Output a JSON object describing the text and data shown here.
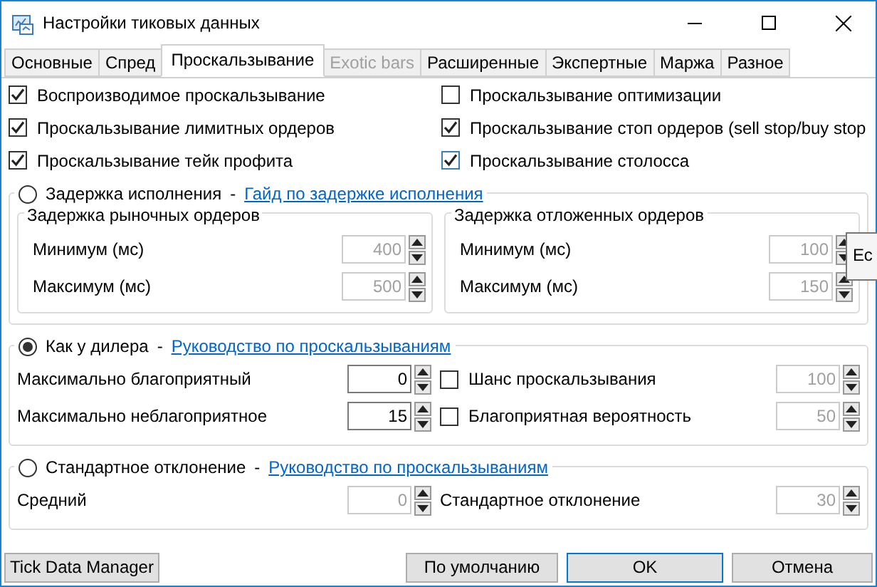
{
  "window": {
    "title": "Настройки тиковых данных"
  },
  "tabs": [
    {
      "label": "Основные",
      "selected": false,
      "disabled": false
    },
    {
      "label": "Спред",
      "selected": false,
      "disabled": false
    },
    {
      "label": "Проскальзывание",
      "selected": true,
      "disabled": false
    },
    {
      "label": "Exotic bars",
      "selected": false,
      "disabled": true
    },
    {
      "label": "Расширенные",
      "selected": false,
      "disabled": false
    },
    {
      "label": "Экспертные",
      "selected": false,
      "disabled": false
    },
    {
      "label": "Маржа",
      "selected": false,
      "disabled": false
    },
    {
      "label": "Разное",
      "selected": false,
      "disabled": false
    }
  ],
  "options": [
    {
      "label": "Воспроизводимое проскальзывание",
      "checked": true
    },
    {
      "label": "Проскальзывание оптимизации",
      "checked": false
    },
    {
      "label": "Проскальзывание лимитных ордеров",
      "checked": true
    },
    {
      "label": "Проскальзывание стоп ордеров (sell stop/buy stop",
      "checked": true
    },
    {
      "label": "Проскальзывание тейк профита",
      "checked": true
    },
    {
      "label": "Проскальзывание столосса",
      "checked": true
    }
  ],
  "tooltip": {
    "text": "Ес"
  },
  "sections": [
    {
      "label": "Задержка исполнения",
      "selected": false,
      "separator": "-",
      "link": "Гайд по задержке исполнения",
      "groups": [
        {
          "title": "Задержка рыночных ордеров",
          "fields": [
            {
              "label": "Минимум (мс)",
              "value": "400",
              "disabled": true
            },
            {
              "label": "Максимум (мс)",
              "value": "500",
              "disabled": true
            }
          ]
        },
        {
          "title": "Задержка отложенных ордеров",
          "fields": [
            {
              "label": "Минимум (мс)",
              "value": "100",
              "disabled": true
            },
            {
              "label": "Максимум (мс)",
              "value": "150",
              "disabled": true
            }
          ]
        }
      ]
    },
    {
      "label": "Как у дилера",
      "selected": true,
      "separator": "-",
      "link": "Руководство по проскальзываниям",
      "rows": [
        {
          "items": [
            {
              "kind": "field",
              "label": "Максимально благоприятный",
              "value": "0",
              "disabled": false
            },
            {
              "kind": "check",
              "label": "Шанс проскальзывания",
              "checked": false,
              "value": "100",
              "disabled": true
            }
          ]
        },
        {
          "items": [
            {
              "kind": "field",
              "label": "Максимально неблагоприятное",
              "value": "15",
              "disabled": false
            },
            {
              "kind": "check",
              "label": "Благоприятная вероятность",
              "checked": false,
              "value": "50",
              "disabled": true
            }
          ]
        }
      ]
    },
    {
      "label": "Стандартное отклонение",
      "selected": false,
      "separator": "-",
      "link": "Руководство по проскальзываниям",
      "rows": [
        {
          "items": [
            {
              "kind": "field",
              "label": "Средний",
              "value": "0",
              "disabled": true
            },
            {
              "kind": "field",
              "label": "Стандартное отклонение",
              "value": "30",
              "disabled": true
            }
          ]
        }
      ]
    }
  ],
  "buttons": [
    {
      "label": "Tick Data Manager",
      "default": false
    },
    {
      "label": "По умолчанию",
      "default": false
    },
    {
      "label": "OK",
      "default": true
    },
    {
      "label": "Отмена",
      "default": false
    }
  ]
}
